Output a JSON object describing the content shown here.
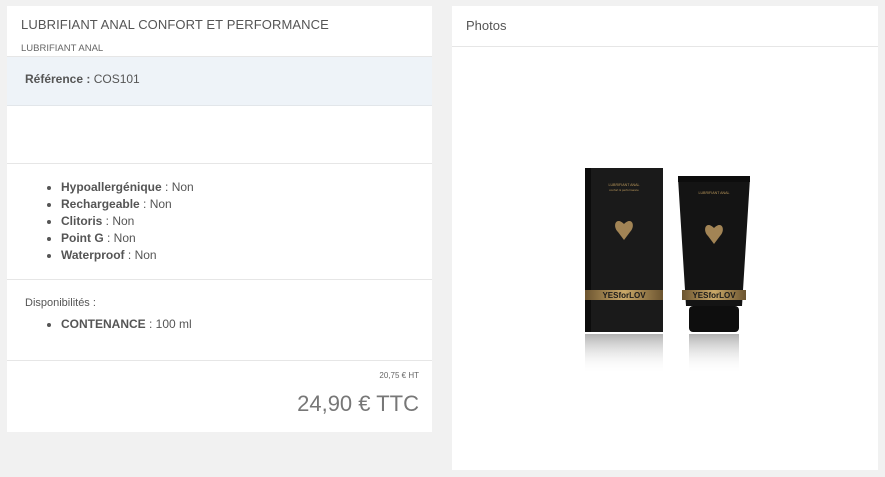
{
  "product": {
    "title": "LUBRIFIANT ANAL CONFORT ET PERFORMANCE",
    "category": "LUBRIFIANT ANAL",
    "reference_label": "Référence :",
    "reference_value": " COS101"
  },
  "features": [
    {
      "label": "Hypoallergénique",
      "value": " : Non"
    },
    {
      "label": "Rechargeable",
      "value": " : Non"
    },
    {
      "label": "Clitoris",
      "value": " : Non"
    },
    {
      "label": "Point G",
      "value": " : Non"
    },
    {
      "label": "Waterproof",
      "value": " : Non"
    }
  ],
  "availability": {
    "label": "Disponibilités :",
    "items": [
      {
        "label": "CONTENANCE",
        "value": " : 100 ml"
      }
    ]
  },
  "price": {
    "ht": "20,75 € HT",
    "ttc": "24,90 € TTC"
  },
  "photos": {
    "header": "Photos",
    "product_image_text": {
      "brand": "YESforLOV",
      "box_line1": "LUBRIFIANT ANAL",
      "box_line2": "confort & performance"
    }
  },
  "colors": {
    "background": "#f1f1f1",
    "reference_bg": "#eef3f8",
    "gold": "#b8965a"
  }
}
